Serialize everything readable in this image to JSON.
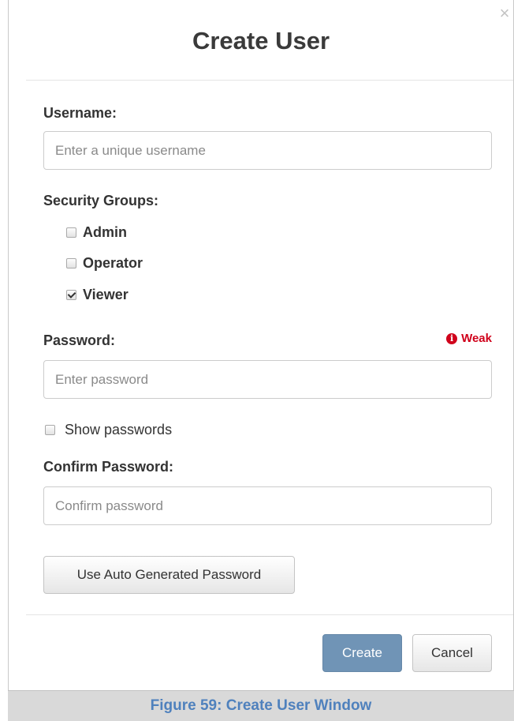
{
  "dialog": {
    "title": "Create User",
    "close_symbol": "×"
  },
  "username": {
    "label": "Username:",
    "placeholder": "Enter a unique username",
    "value": ""
  },
  "security_groups": {
    "label": "Security Groups:",
    "options": [
      {
        "label": "Admin",
        "checked": false
      },
      {
        "label": "Operator",
        "checked": false
      },
      {
        "label": "Viewer",
        "checked": true
      }
    ]
  },
  "password": {
    "label": "Password:",
    "placeholder": "Enter password",
    "value": "",
    "strength_label": "Weak",
    "strength_icon": "info-circle-icon",
    "strength_color": "#d0021b"
  },
  "show_passwords": {
    "label": "Show passwords",
    "checked": false
  },
  "confirm_password": {
    "label": "Confirm Password:",
    "placeholder": "Confirm password",
    "value": ""
  },
  "buttons": {
    "auto_generate": "Use Auto Generated Password",
    "create": "Create",
    "cancel": "Cancel"
  },
  "colors": {
    "primary_button": "#7094b6",
    "caption_text": "#4f81bd"
  },
  "caption": "Figure 59: Create User Window"
}
